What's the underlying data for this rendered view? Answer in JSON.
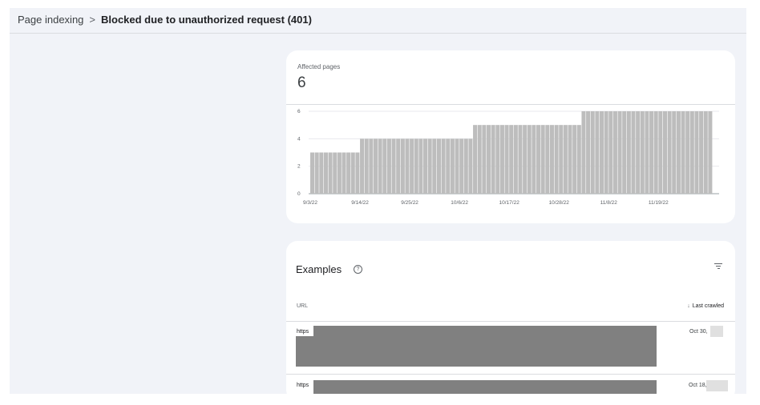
{
  "breadcrumb": {
    "parent": "Page indexing",
    "separator": ">",
    "current": "Blocked due to unauthorized request (401)"
  },
  "summary": {
    "label": "Affected pages",
    "value": "6"
  },
  "chart_data": {
    "type": "bar",
    "title": "",
    "xlabel": "",
    "ylabel": "",
    "ylim": [
      0,
      6
    ],
    "yticks": [
      "0",
      "2",
      "4",
      "6"
    ],
    "xticks": [
      "9/3/22",
      "9/14/22",
      "9/25/22",
      "10/6/22",
      "10/17/22",
      "10/28/22",
      "11/8/22",
      "11/19/22"
    ],
    "series": [
      {
        "values": [
          3,
          3,
          3,
          3,
          3,
          3,
          3,
          3,
          3,
          3,
          3,
          4,
          4,
          4,
          4,
          4,
          4,
          4,
          4,
          4,
          4,
          4,
          4,
          4,
          4,
          4,
          4,
          4,
          4,
          4,
          4,
          4,
          4,
          4,
          4,
          4,
          5,
          5,
          5,
          5,
          5,
          5,
          5,
          5,
          5,
          5,
          5,
          5,
          5,
          5,
          5,
          5,
          5,
          5,
          5,
          5,
          5,
          5,
          5,
          5,
          6,
          6,
          6,
          6,
          6,
          6,
          6,
          6,
          6,
          6,
          6,
          6,
          6,
          6,
          6,
          6,
          6,
          6,
          6,
          6,
          6,
          6,
          6,
          6,
          6,
          6,
          6,
          6,
          6
        ]
      }
    ],
    "bar_color": "#bdbdbd"
  },
  "examples": {
    "title": "Examples",
    "help_icon": "help-circle-icon",
    "filter_icon": "filter-icon",
    "columns": {
      "url": "URL",
      "last_crawled": "Last crawled",
      "sort_icon": "arrow-down-icon"
    },
    "rows": [
      {
        "url": "https",
        "date": "Oct 30, "
      },
      {
        "url": "https",
        "date": "Oct 18,"
      }
    ]
  }
}
